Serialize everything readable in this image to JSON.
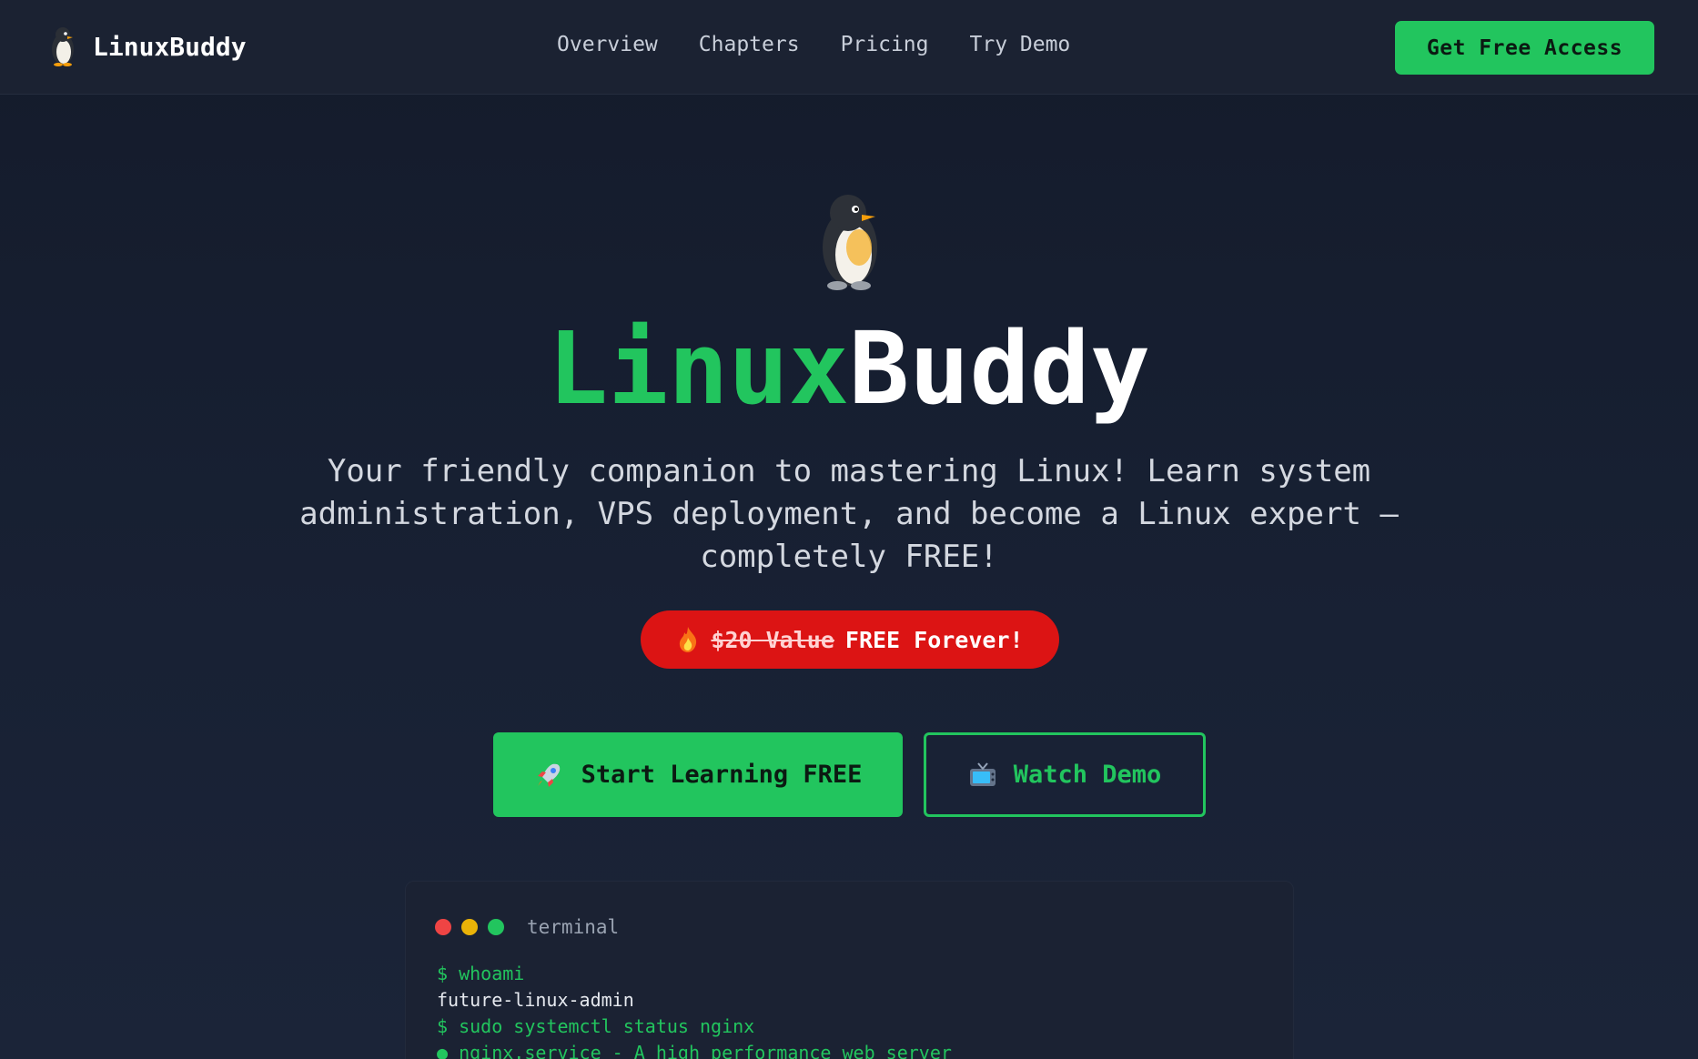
{
  "nav": {
    "brand": "LinuxBuddy",
    "links": [
      "Overview",
      "Chapters",
      "Pricing",
      "Try Demo"
    ],
    "cta": "Get Free Access"
  },
  "hero": {
    "title_part1": "Linux",
    "title_part2": "Buddy",
    "subtitle": "Your friendly companion to mastering Linux! Learn system administration, VPS deployment, and become a Linux expert – completely FREE!",
    "badge": {
      "strike_text": "$20 Value",
      "text": "FREE Forever!",
      "icon": "fire-icon"
    },
    "primary_button": "Start Learning FREE",
    "secondary_button": "Watch Demo"
  },
  "terminal": {
    "title": "terminal",
    "lines": [
      {
        "type": "cmd",
        "text": "$ whoami"
      },
      {
        "type": "out",
        "text": "future-linux-admin"
      },
      {
        "type": "cmd",
        "text": "$ sudo systemctl status nginx"
      },
      {
        "type": "status",
        "text": "● nginx.service - A high performance web server"
      }
    ]
  },
  "colors": {
    "accent": "#22c55e",
    "badge": "#dc1414",
    "background": "#141b2b",
    "nav": "#1b2232"
  }
}
